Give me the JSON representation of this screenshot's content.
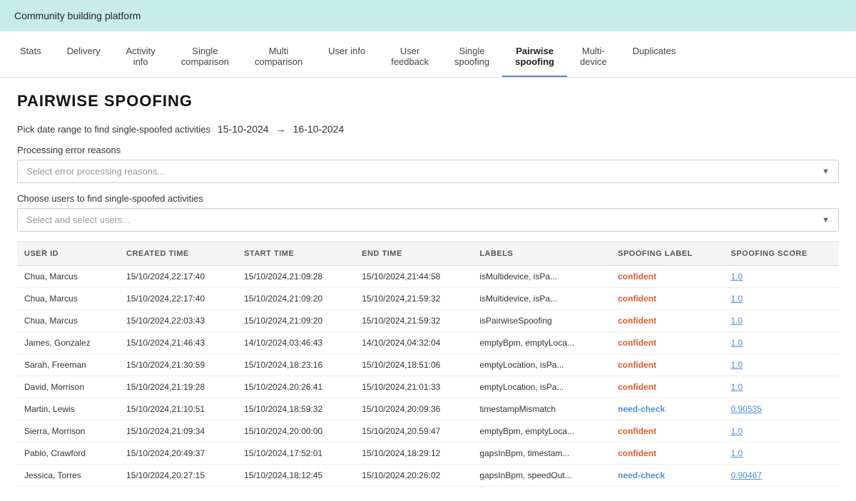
{
  "app": {
    "title": "Community building platform"
  },
  "tabs": [
    {
      "id": "stats",
      "label": "Stats",
      "active": false
    },
    {
      "id": "delivery",
      "label": "Delivery",
      "active": false
    },
    {
      "id": "activity-info",
      "label": "Activity\ninfo",
      "active": false
    },
    {
      "id": "single-comparison",
      "label": "Single\ncomparison",
      "active": false
    },
    {
      "id": "multi-comparison",
      "label": "Multi\ncomparison",
      "active": false
    },
    {
      "id": "user-info",
      "label": "User info",
      "active": false
    },
    {
      "id": "user-feedback",
      "label": "User\nfeedback",
      "active": false
    },
    {
      "id": "single-spoofing",
      "label": "Single\nspoofing",
      "active": false
    },
    {
      "id": "pairwise-spoofing",
      "label": "Pairwise\nspoofing",
      "active": true
    },
    {
      "id": "multi-device",
      "label": "Multi-\ndevice",
      "active": false
    },
    {
      "id": "duplicates",
      "label": "Duplicates",
      "active": false
    }
  ],
  "page": {
    "title": "PAIRWISE SPOOFING",
    "date_label": "Pick date range to find single-spoofed activities",
    "date_start": "15-10-2024",
    "date_arrow": "→",
    "date_end": "16-10-2024",
    "error_label": "Processing error reasons",
    "error_placeholder": "Select error processing reasons...",
    "users_label": "Choose users to find single-spoofed activities",
    "users_placeholder": "Select and select users..."
  },
  "table": {
    "columns": [
      {
        "id": "user-id",
        "label": "USER ID"
      },
      {
        "id": "created-time",
        "label": "CREATED TIME"
      },
      {
        "id": "start-time",
        "label": "START TIME"
      },
      {
        "id": "end-time",
        "label": "END TIME"
      },
      {
        "id": "labels",
        "label": "LABELS"
      },
      {
        "id": "spoofing-label",
        "label": "SPOOFING LABEL"
      },
      {
        "id": "spoofing-score",
        "label": "SPOOFING SCORE"
      }
    ],
    "rows": [
      {
        "user_id": "Chua, Marcus",
        "created": "15/10/2024,22:17:40",
        "start": "15/10/2024,21:09:28",
        "end": "15/10/2024,21:44:58",
        "labels": "isMultidevice, isPa...",
        "spoofing_label": "confident",
        "spoofing_label_class": "confident",
        "score": "1.0"
      },
      {
        "user_id": "Chua, Marcus",
        "created": "15/10/2024,22:17:40",
        "start": "15/10/2024,21:09:20",
        "end": "15/10/2024,21:59:32",
        "labels": "isMultidevice, isPa...",
        "spoofing_label": "confident",
        "spoofing_label_class": "confident",
        "score": "1.0"
      },
      {
        "user_id": "Chua, Marcus",
        "created": "15/10/2024,22:03:43",
        "start": "15/10/2024,21:09:20",
        "end": "15/10/2024,21:59:32",
        "labels": "isPairwiseSpoofing",
        "spoofing_label": "confident",
        "spoofing_label_class": "confident",
        "score": "1.0"
      },
      {
        "user_id": "James, Gonzalez",
        "created": "15/10/2024,21:46:43",
        "start": "14/10/2024,03:46:43",
        "end": "14/10/2024,04:32:04",
        "labels": "emptyBpm, emptyLoca...",
        "spoofing_label": "confident",
        "spoofing_label_class": "confident",
        "score": "1.0"
      },
      {
        "user_id": "Sarah, Freeman",
        "created": "15/10/2024,21:30:59",
        "start": "15/10/2024,18:23:16",
        "end": "15/10/2024,18:51:06",
        "labels": "emptyLocation, isPa...",
        "spoofing_label": "confident",
        "spoofing_label_class": "confident",
        "score": "1.0"
      },
      {
        "user_id": "David, Morrison",
        "created": "15/10/2024,21:19:28",
        "start": "15/10/2024,20:26:41",
        "end": "15/10/2024,21:01:33",
        "labels": "emptyLocation, isPa...",
        "spoofing_label": "confident",
        "spoofing_label_class": "confident",
        "score": "1.0"
      },
      {
        "user_id": "Martin, Lewis",
        "created": "15/10/2024,21:10:51",
        "start": "15/10/2024,18:59:32",
        "end": "15/10/2024,20:09:36",
        "labels": "timestampMismatch",
        "spoofing_label": "need-check",
        "spoofing_label_class": "need-check",
        "score": "0.90535"
      },
      {
        "user_id": "Sierra, Morrison",
        "created": "15/10/2024,21:09:34",
        "start": "15/10/2024,20:00:00",
        "end": "15/10/2024,20:59:47",
        "labels": "emptyBpm, emptyLoca...",
        "spoofing_label": "confident",
        "spoofing_label_class": "confident",
        "score": "1.0"
      },
      {
        "user_id": "Pablo, Crawford",
        "created": "15/10/2024,20:49:37",
        "start": "15/10/2024,17:52:01",
        "end": "15/10/2024,18:29:12",
        "labels": "gapsInBpm, timestam...",
        "spoofing_label": "confident",
        "spoofing_label_class": "confident",
        "score": "1.0"
      },
      {
        "user_id": "Jessica, Torres",
        "created": "15/10/2024,20:27:15",
        "start": "15/10/2024,18:12:45",
        "end": "15/10/2024,20:26:02",
        "labels": "gapsInBpm, speedOut...",
        "spoofing_label": "need-check",
        "spoofing_label_class": "need-check",
        "score": "0.90467"
      }
    ]
  }
}
